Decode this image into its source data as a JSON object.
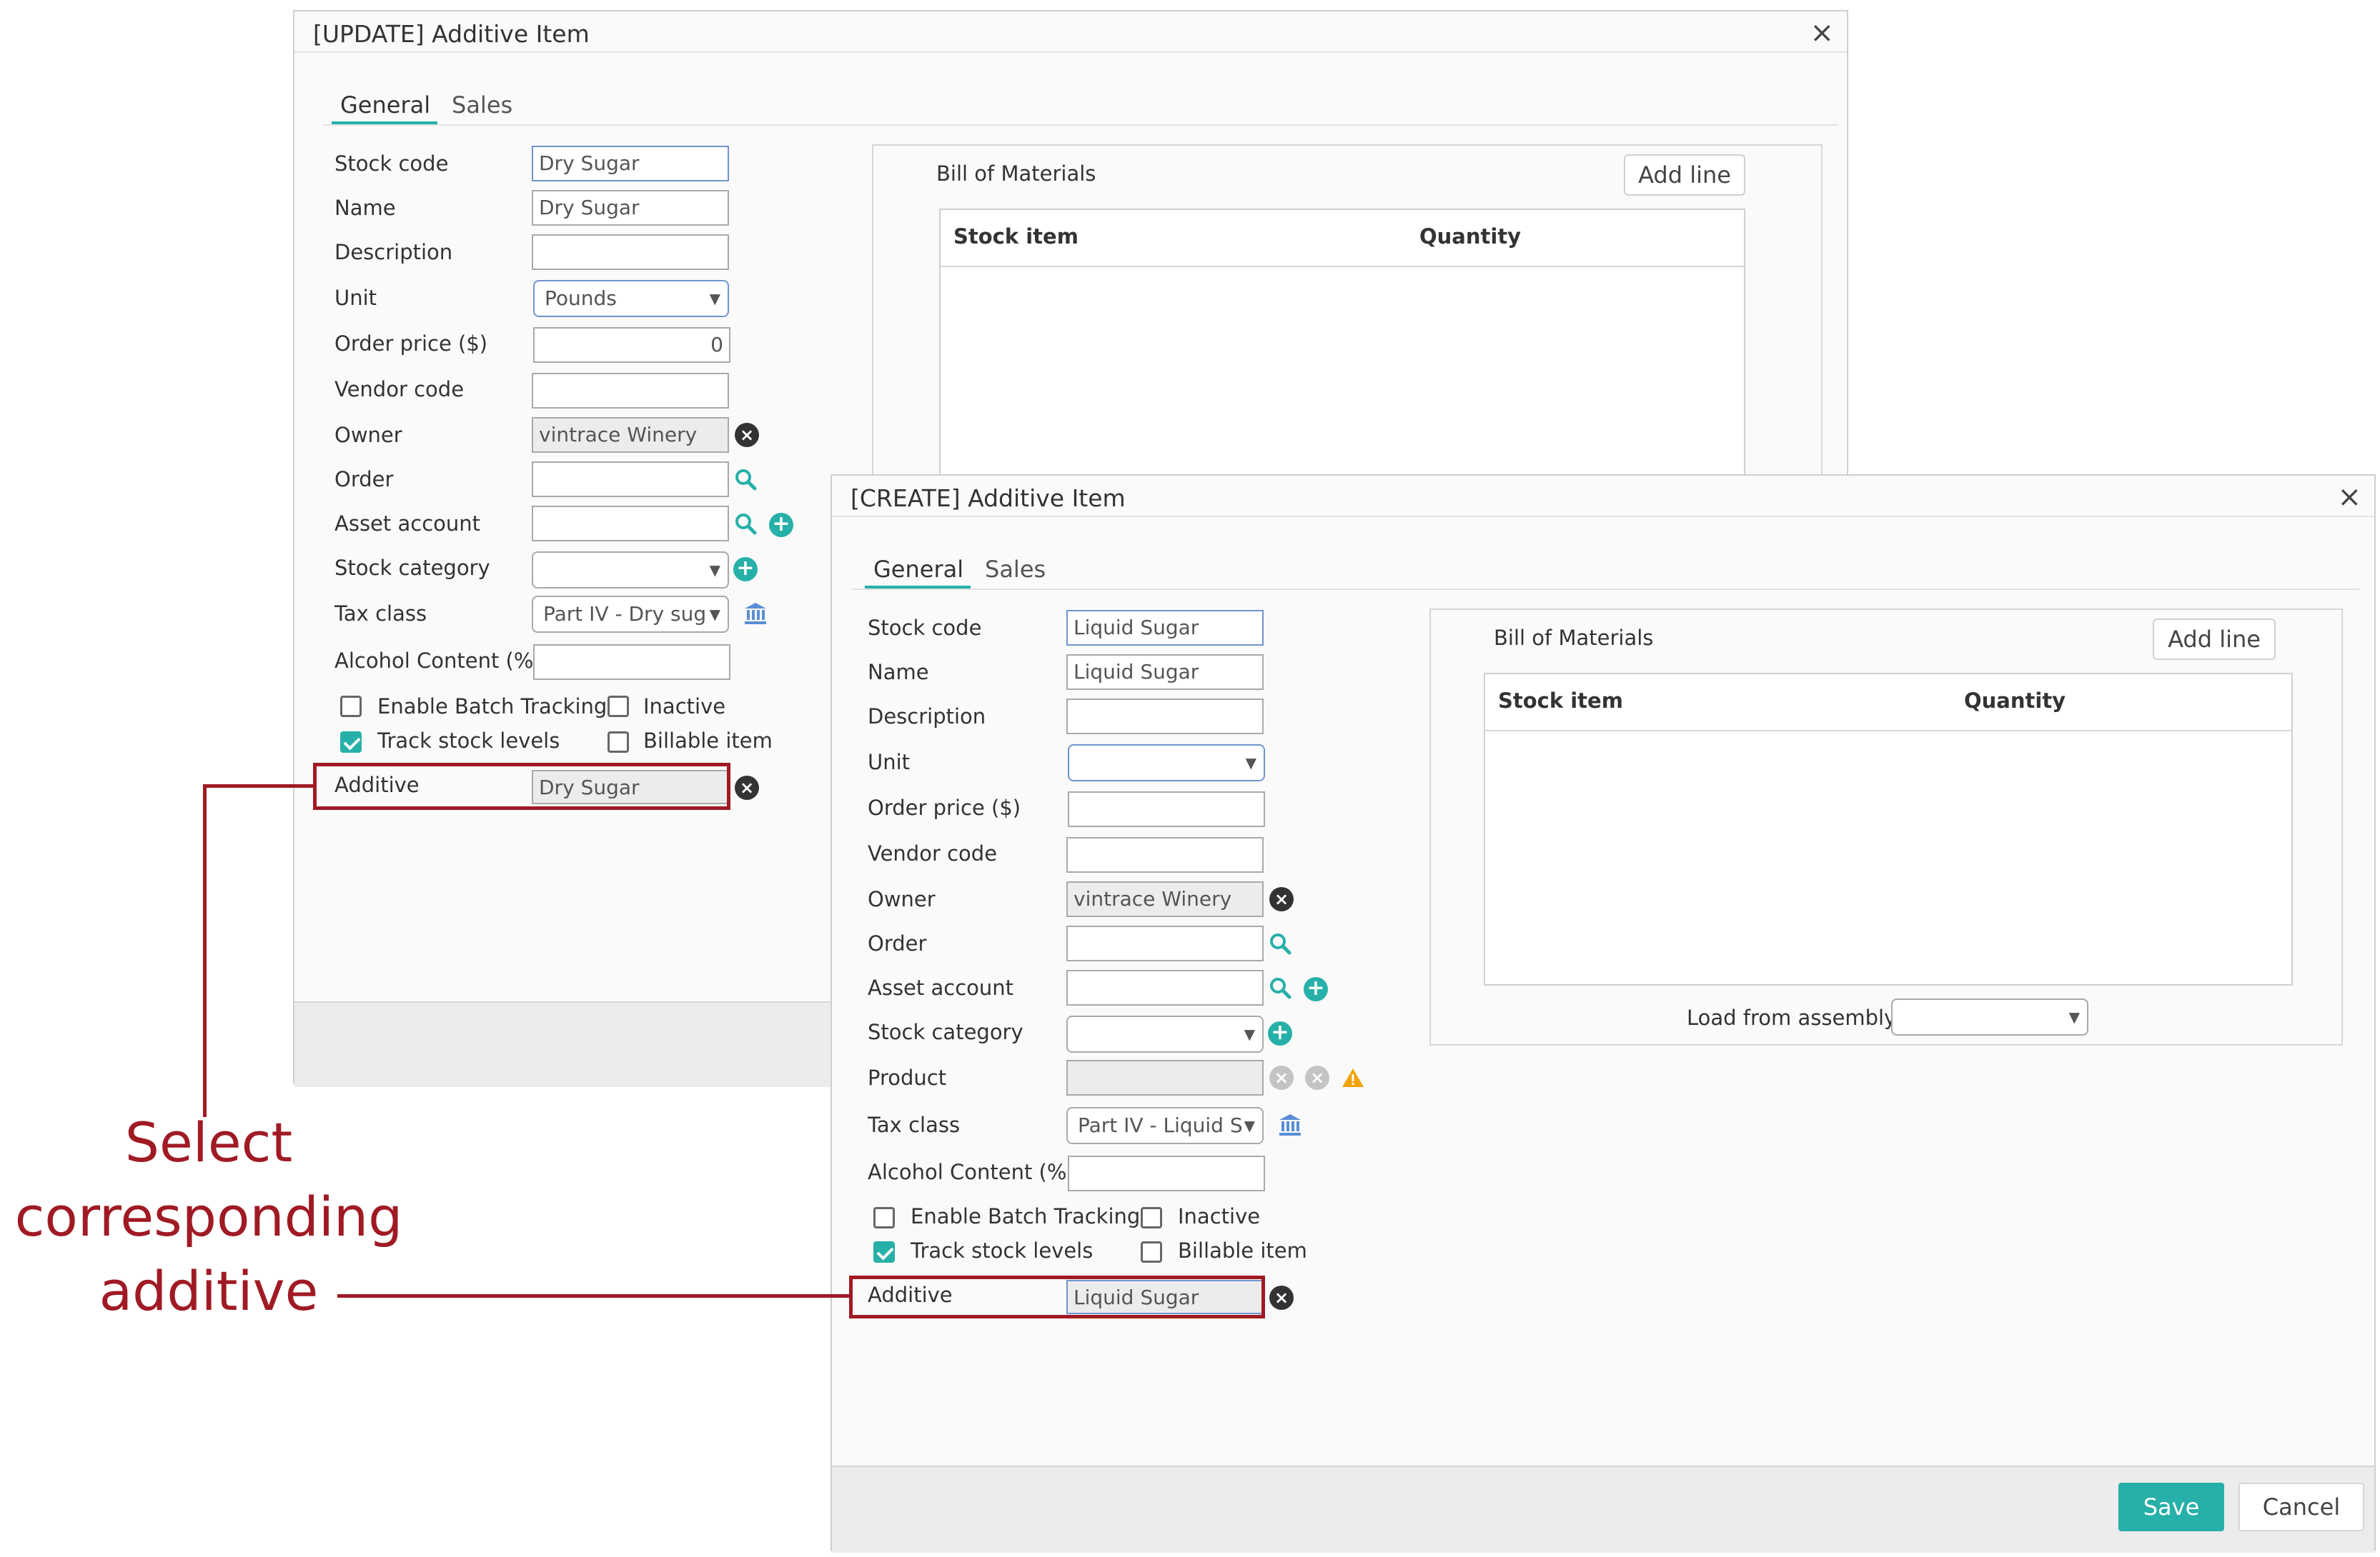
{
  "colors": {
    "accent": "#26b0a9",
    "highlight": "#a01a24",
    "focus_border": "#6f94cf"
  },
  "update_dialog": {
    "title": "[UPDATE] Additive Item",
    "close": "×",
    "tabs": [
      "General",
      "Sales"
    ],
    "fields": {
      "stock_code": {
        "label": "Stock code",
        "value": "Dry Sugar"
      },
      "name": {
        "label": "Name",
        "value": "Dry Sugar"
      },
      "description": {
        "label": "Description",
        "value": ""
      },
      "unit": {
        "label": "Unit",
        "value": "Pounds"
      },
      "order_price": {
        "label": "Order price ($)",
        "value": "0"
      },
      "vendor_code": {
        "label": "Vendor code",
        "value": ""
      },
      "owner": {
        "label": "Owner",
        "value": "vintrace Winery"
      },
      "order": {
        "label": "Order",
        "value": ""
      },
      "asset_account": {
        "label": "Asset account",
        "value": ""
      },
      "stock_category": {
        "label": "Stock category",
        "value": ""
      },
      "tax_class": {
        "label": "Tax class",
        "value": "Part IV - Dry sug"
      },
      "alcohol_content": {
        "label": "Alcohol Content (%)",
        "value": ""
      },
      "additive": {
        "label": "Additive",
        "value": "Dry Sugar"
      }
    },
    "checkboxes": {
      "enable_batch": {
        "label": "Enable Batch Tracking",
        "checked": false
      },
      "inactive": {
        "label": "Inactive",
        "checked": false
      },
      "track_stock": {
        "label": "Track stock levels",
        "checked": true
      },
      "billable": {
        "label": "Billable item",
        "checked": false
      }
    },
    "bom": {
      "title": "Bill of Materials",
      "add_line": "Add line",
      "col_stock_item": "Stock item",
      "col_quantity": "Quantity"
    }
  },
  "create_dialog": {
    "title": "[CREATE] Additive Item",
    "close": "×",
    "tabs": [
      "General",
      "Sales"
    ],
    "fields": {
      "stock_code": {
        "label": "Stock code",
        "value": "Liquid Sugar"
      },
      "name": {
        "label": "Name",
        "value": "Liquid Sugar"
      },
      "description": {
        "label": "Description",
        "value": ""
      },
      "unit": {
        "label": "Unit",
        "value": ""
      },
      "order_price": {
        "label": "Order price ($)",
        "value": ""
      },
      "vendor_code": {
        "label": "Vendor code",
        "value": ""
      },
      "owner": {
        "label": "Owner",
        "value": "vintrace Winery"
      },
      "order": {
        "label": "Order",
        "value": ""
      },
      "asset_account": {
        "label": "Asset account",
        "value": ""
      },
      "stock_category": {
        "label": "Stock category",
        "value": ""
      },
      "product": {
        "label": "Product",
        "value": ""
      },
      "tax_class": {
        "label": "Tax class",
        "value": "Part IV - Liquid S"
      },
      "alcohol_content": {
        "label": "Alcohol Content (%)",
        "value": ""
      },
      "additive": {
        "label": "Additive",
        "value": "Liquid Sugar"
      }
    },
    "checkboxes": {
      "enable_batch": {
        "label": "Enable Batch Tracking",
        "checked": false
      },
      "inactive": {
        "label": "Inactive",
        "checked": false
      },
      "track_stock": {
        "label": "Track stock levels",
        "checked": true
      },
      "billable": {
        "label": "Billable item",
        "checked": false
      }
    },
    "bom": {
      "title": "Bill of Materials",
      "add_line": "Add line",
      "col_stock_item": "Stock item",
      "col_quantity": "Quantity",
      "load_from_assembly": "Load from assembly"
    },
    "save_label": "Save",
    "cancel_label": "Cancel"
  },
  "annotation": {
    "line1": "Select",
    "line2": "corresponding",
    "line3": "additive"
  },
  "icons": {
    "clear": "clear-icon",
    "search": "search-icon",
    "add": "add-icon",
    "tax": "bank-icon",
    "warning": "warning-icon",
    "dropdown": "chevron-down-icon"
  }
}
